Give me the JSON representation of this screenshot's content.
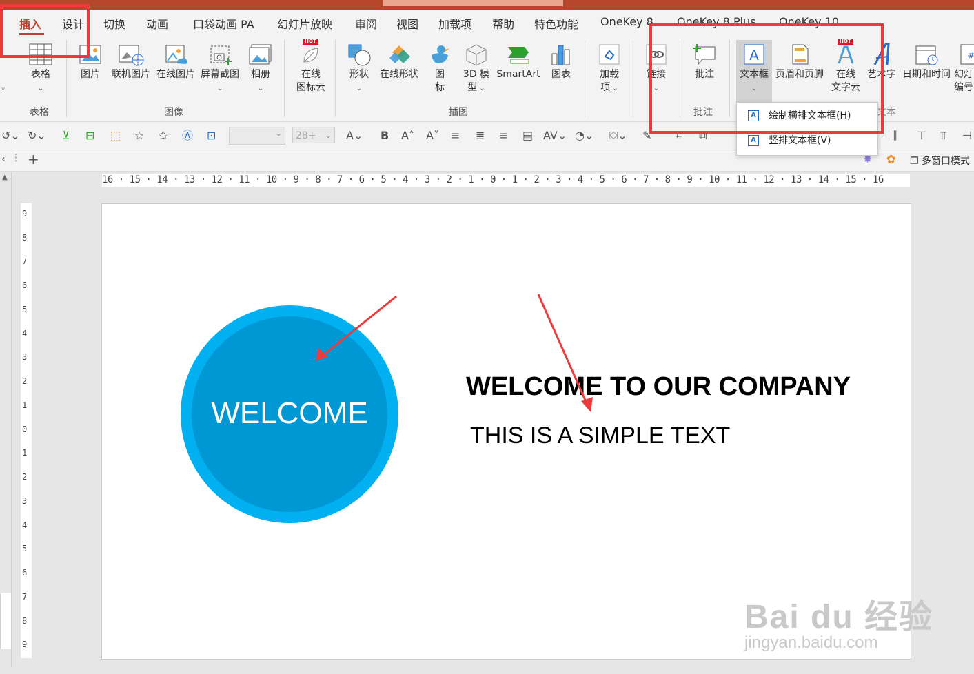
{
  "tabs": [
    "插入",
    "设计",
    "切换",
    "动画",
    "口袋动画 PA",
    "幻灯片放映",
    "审阅",
    "视图",
    "加载项",
    "帮助",
    "特色功能",
    "OneKey 8",
    "OneKey 8 Plus",
    "OneKey 10"
  ],
  "active_tab": "插入",
  "ribbon": {
    "table": {
      "label": "表格",
      "group": "表格"
    },
    "images": {
      "items": [
        "图片",
        "联机图片",
        "在线图片",
        "屏幕截图",
        "相册"
      ],
      "group": "图像"
    },
    "icon_cloud": {
      "line1": "在线",
      "line2": "图标云",
      "hot": "HOT"
    },
    "illustrations": {
      "shapes": "形状",
      "online_shapes": "在线形状",
      "icons_1": "图",
      "icons_2": "标",
      "model_1": "3D 模",
      "model_2": "型",
      "smartart": "SmartArt",
      "chart": "图表",
      "group": "插图"
    },
    "addins": {
      "line1": "加载",
      "line2": "项"
    },
    "link": {
      "label": "链接"
    },
    "comment": {
      "label": "批注",
      "group": "批注"
    },
    "text": {
      "textbox": "文本框",
      "header_footer": "页眉和页脚",
      "online_text_1": "在线",
      "online_text_2": "文字云",
      "wordart": "艺术字",
      "datetime": "日期和时间",
      "slide_num_1": "幻灯",
      "slide_num_2": "编号",
      "group": "文本",
      "hot": "HOT"
    }
  },
  "toolbar": {
    "font_size": "28+"
  },
  "dropdown": {
    "items": [
      "绘制横排文本框(H)",
      "竖排文本框(V)"
    ]
  },
  "tabrow": {
    "multiwindow": "多窗口模式"
  },
  "ruler_h": "16 · 15 · 14 · 13 · 12 · 11 · 10 · 9 · 8 · 7 · 6 · 5 · 4 · 3 · 2 · 1 · 0 · 1 · 2 · 3 · 4 · 5 · 6 · 7 · 8 · 9 · 10 · 11 · 12 · 13 · 14 · 15 · 16",
  "ruler_v": [
    "9",
    "8",
    "7",
    "6",
    "5",
    "4",
    "3",
    "2",
    "1",
    "0",
    "1",
    "2",
    "3",
    "4",
    "5",
    "6",
    "7",
    "8",
    "9"
  ],
  "slide": {
    "circle_text": "WELCOME",
    "headline": "WELCOME TO OUR COMPANY",
    "subtext": "THIS IS A SIMPLE TEXT"
  },
  "watermark": {
    "line1": "Bai du 经验",
    "line2": "jingyan.baidu.com"
  },
  "colors": {
    "accent": "#b7472a",
    "circle_outer": "#00b0f0",
    "circle_inner": "#0098d4",
    "highlight": "#ee3a3a"
  }
}
